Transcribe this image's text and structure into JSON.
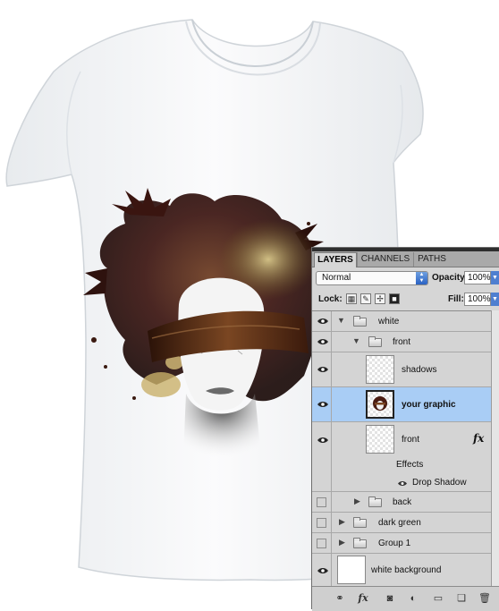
{
  "panel": {
    "tabs": [
      "LAYERS",
      "CHANNELS",
      "PATHS"
    ],
    "blend_mode": "Normal",
    "opacity_label": "Opacity:",
    "opacity_value": "100%",
    "lock_label": "Lock:",
    "fill_label": "Fill:",
    "fill_value": "100%"
  },
  "layers": [
    {
      "name": "white",
      "type": "group",
      "visible": true
    },
    {
      "name": "front",
      "type": "group",
      "visible": true
    },
    {
      "name": "shadows",
      "type": "layer",
      "visible": true
    },
    {
      "name": "your graphic",
      "type": "layer",
      "visible": true,
      "selected": true
    },
    {
      "name": "front",
      "type": "layer",
      "visible": true,
      "fx": "fx"
    },
    {
      "name": "Effects",
      "type": "effects-header"
    },
    {
      "name": "Drop Shadow",
      "type": "effect",
      "visible": true
    },
    {
      "name": "back",
      "type": "group",
      "visible": false
    },
    {
      "name": "dark green",
      "type": "group",
      "visible": false
    },
    {
      "name": "Group 1",
      "type": "group",
      "visible": false
    },
    {
      "name": "white background",
      "type": "layer",
      "visible": true
    }
  ],
  "footer_icons": [
    "link-icon",
    "fx-icon",
    "mask-icon",
    "adjustment-icon",
    "new-group-icon",
    "new-layer-icon",
    "trash-icon"
  ],
  "colors": {
    "selected_row": "#a9cdf5",
    "panel_bg": "#d6d6d6",
    "accent_blue": "#2a62c4"
  }
}
